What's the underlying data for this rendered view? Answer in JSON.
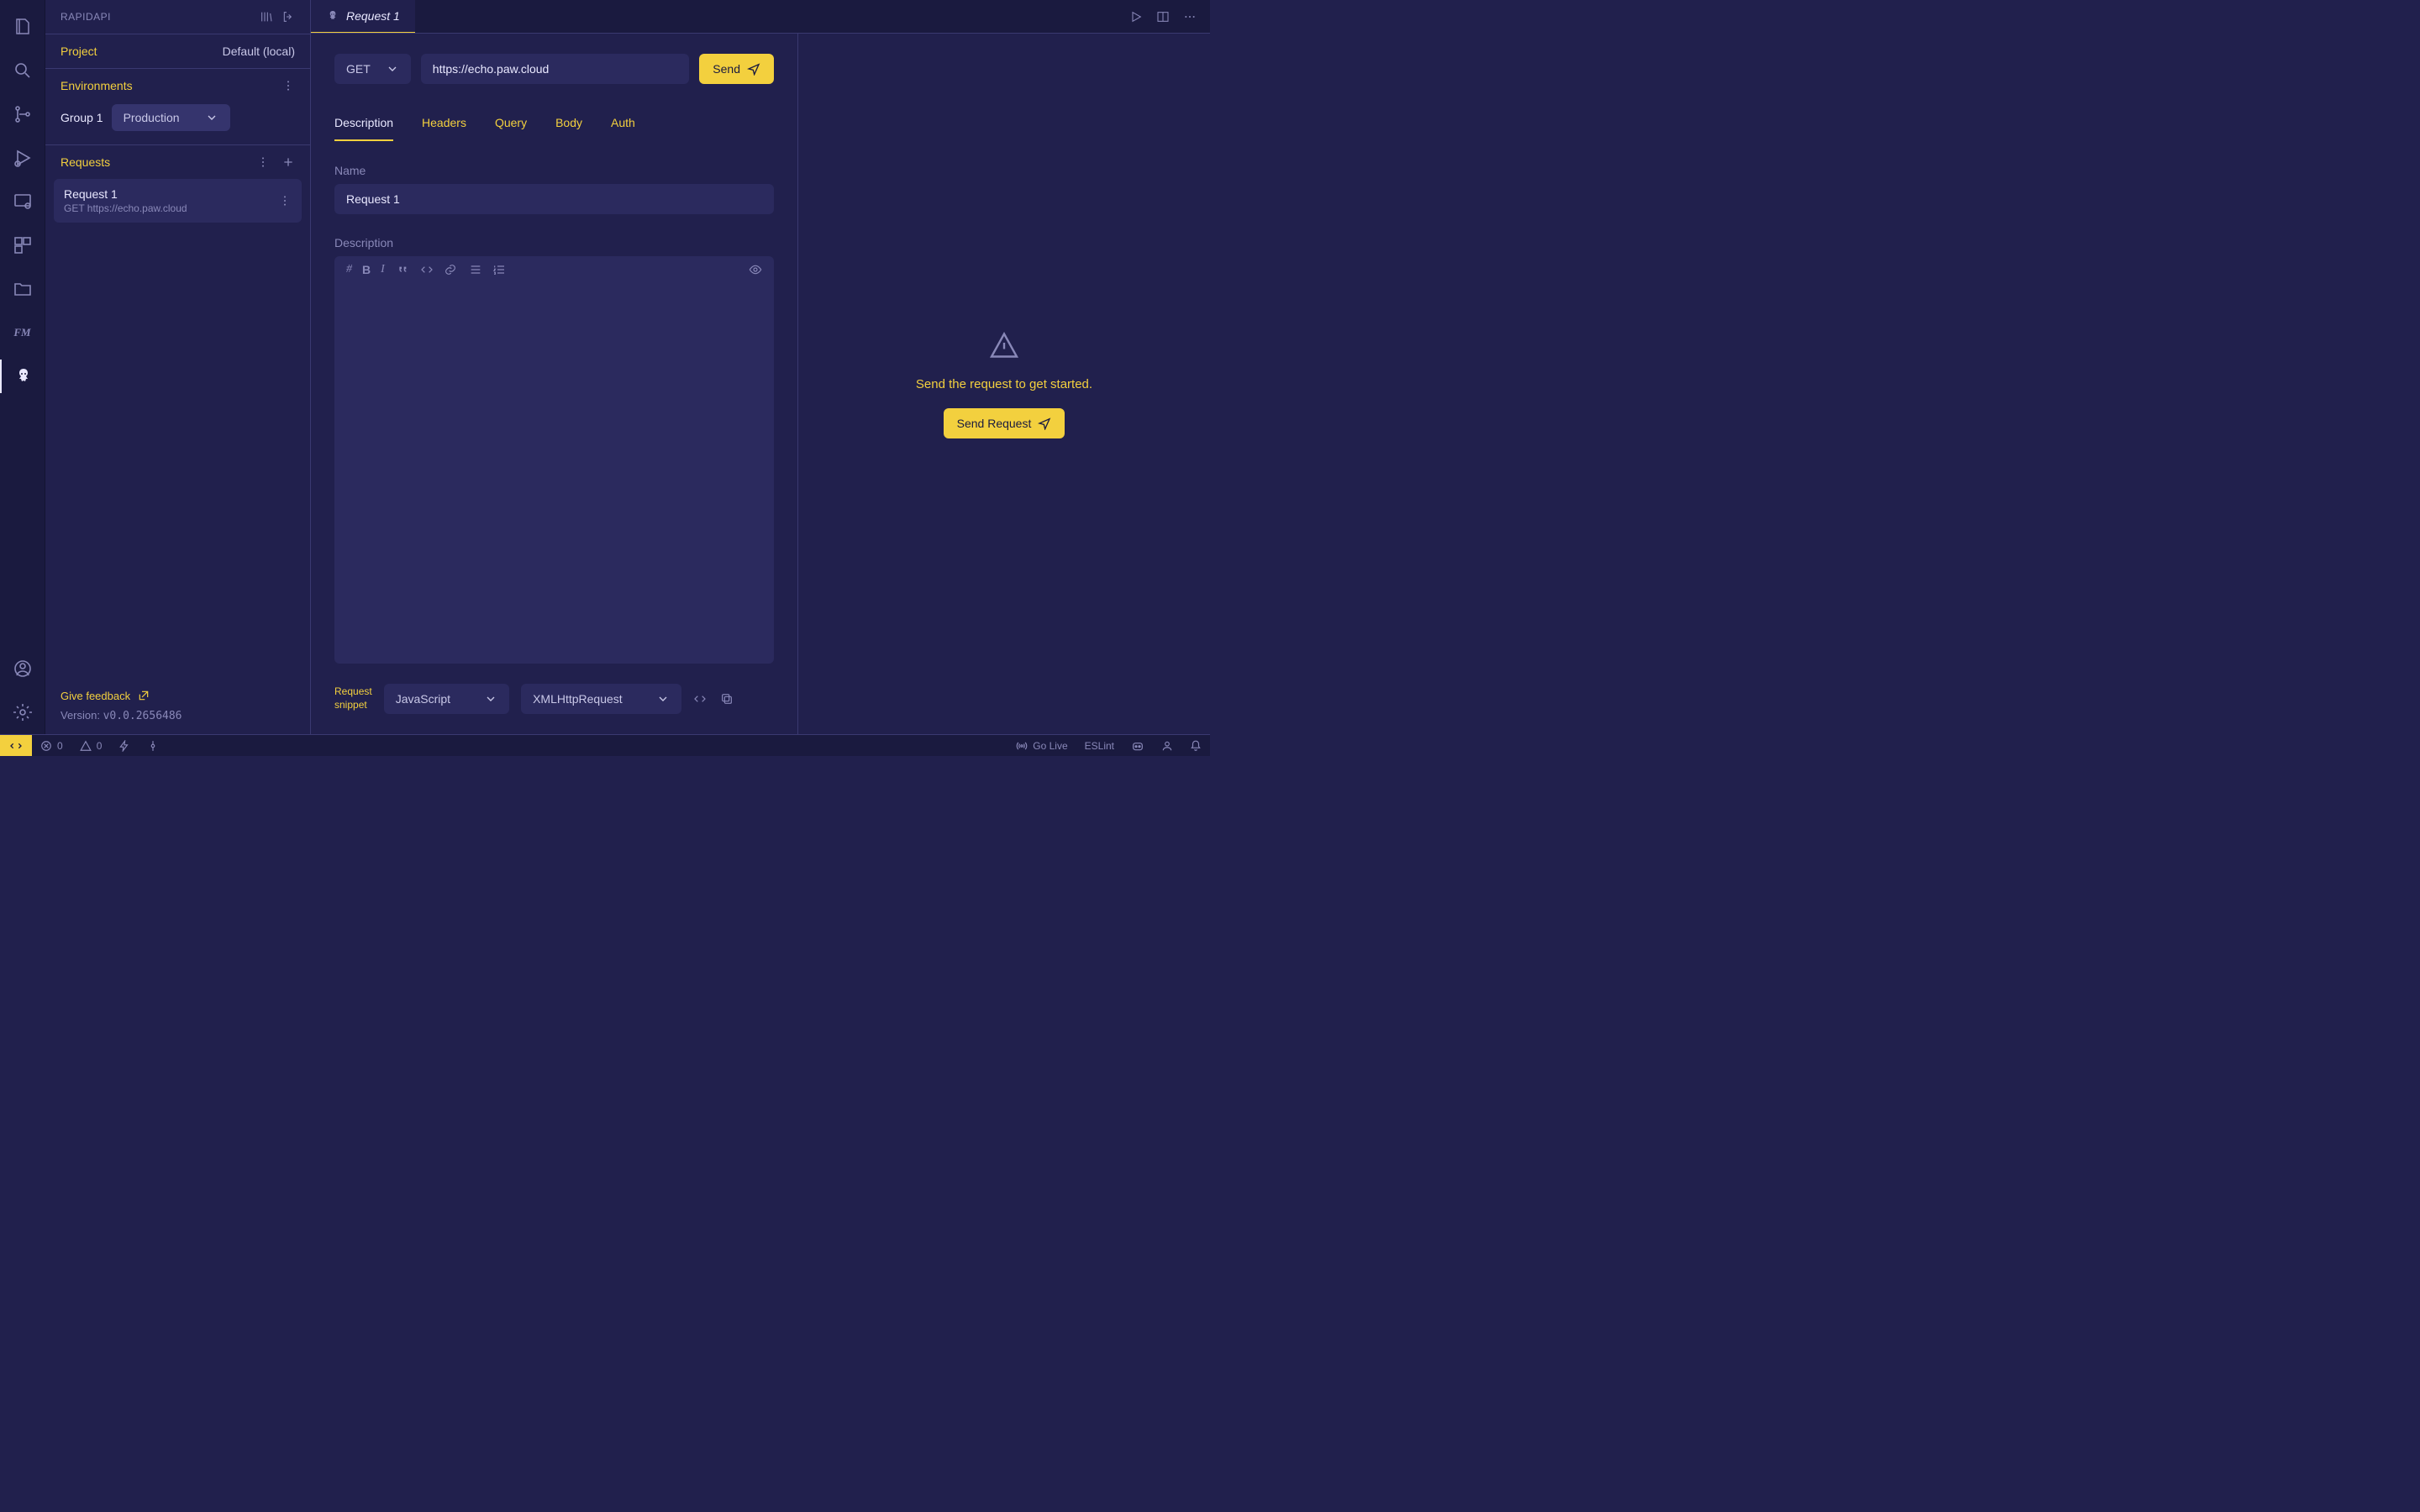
{
  "sidebar_title": "RAPIDAPI",
  "project": {
    "label": "Project",
    "value": "Default (local)"
  },
  "environments": {
    "label": "Environments",
    "group": "Group 1",
    "selected": "Production"
  },
  "requests": {
    "label": "Requests",
    "items": [
      {
        "title": "Request 1",
        "method": "GET",
        "url": "https://echo.paw.cloud"
      }
    ]
  },
  "feedback": {
    "label": "Give feedback"
  },
  "version": {
    "label": "Version: ",
    "value": "v0.0.2656486"
  },
  "tab": {
    "title": "Request 1"
  },
  "request_bar": {
    "method": "GET",
    "url": "https://echo.paw.cloud",
    "send": "Send"
  },
  "request_tabs": [
    "Description",
    "Headers",
    "Query",
    "Body",
    "Auth"
  ],
  "fields": {
    "name_label": "Name",
    "name_value": "Request 1",
    "desc_label": "Description"
  },
  "snippet": {
    "label": "Request\nsnippet",
    "lang": "JavaScript",
    "lib": "XMLHttpRequest"
  },
  "response": {
    "message": "Send the request to get started.",
    "button": "Send Request"
  },
  "statusbar": {
    "errors": "0",
    "warnings": "0",
    "golive": "Go Live",
    "eslint": "ESLint"
  }
}
